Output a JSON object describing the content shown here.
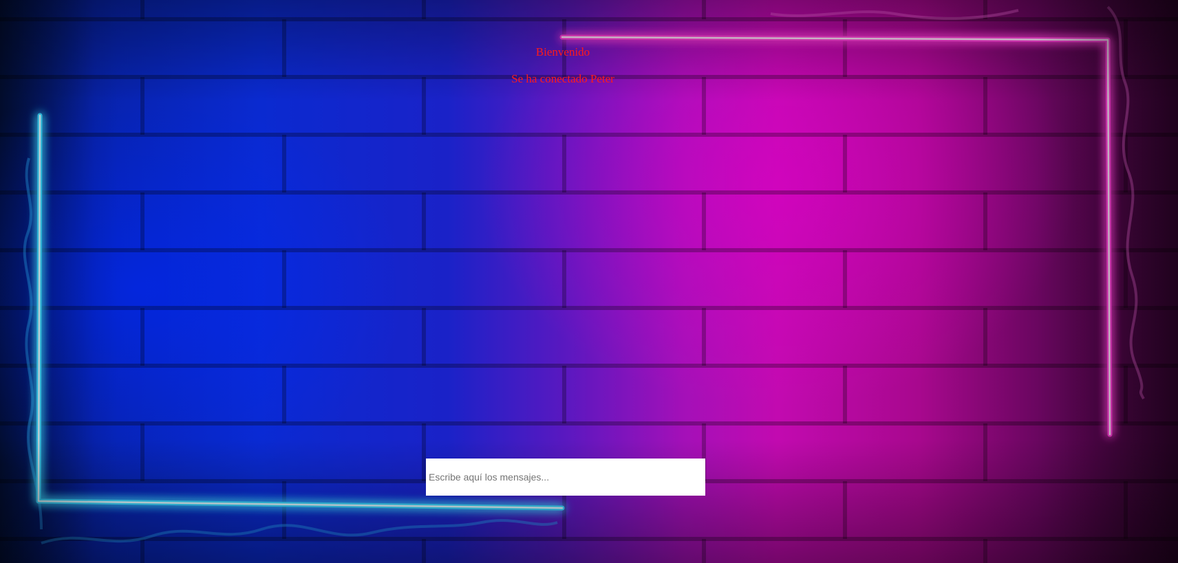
{
  "chat": {
    "title": "Bienvenido",
    "status": "Se ha conectado Peter",
    "input_placeholder": "Escribe aquí los mensajes..."
  },
  "decor": {
    "background": "neon-brick-wall",
    "neon_left_color": "#3ad7ff",
    "neon_right_color": "#ff3fd8",
    "text_color": "#ff1a1a"
  }
}
